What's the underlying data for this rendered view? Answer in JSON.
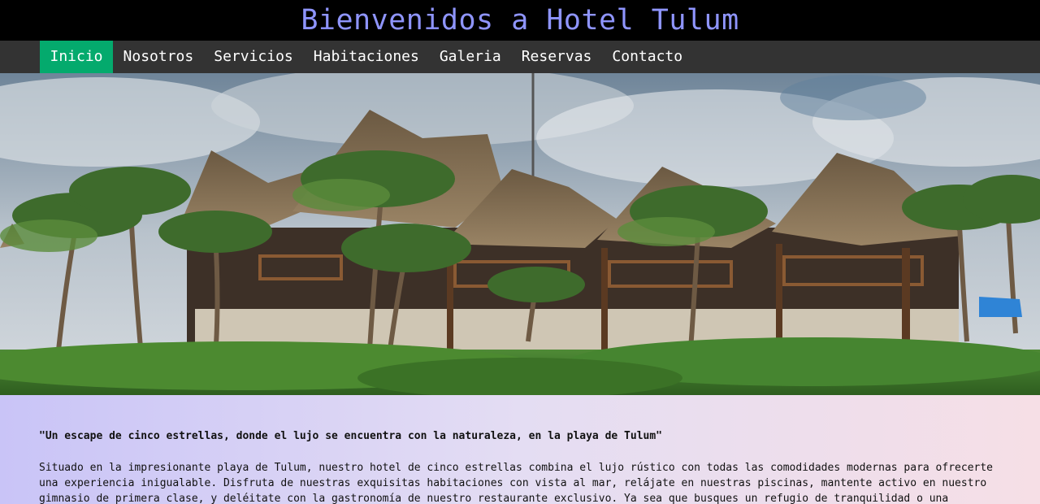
{
  "header": {
    "title": "Bienvenidos a Hotel Tulum"
  },
  "nav": {
    "items": [
      {
        "label": "Inicio",
        "active": true
      },
      {
        "label": "Nosotros"
      },
      {
        "label": "Servicios"
      },
      {
        "label": "Habitaciones"
      },
      {
        "label": "Galeria"
      },
      {
        "label": "Reservas"
      },
      {
        "label": "Contacto"
      }
    ]
  },
  "hero": {
    "image": "hotel-tulum-palapa-cabanas-photo"
  },
  "main": {
    "tagline": "\"Un escape de cinco estrellas, donde el lujo se encuentra con la naturaleza, en la playa de Tulum\"",
    "description": "Situado en la impresionante playa de Tulum, nuestro hotel de cinco estrellas combina el lujo rústico con todas las comodidades modernas para ofrecerte una experiencia inigualable. Disfruta de nuestras exquisitas habitaciones con vista al mar, relájate en nuestras piscinas, mantente activo en nuestro gimnasio de primera clase, y deléitate con la gastronomía de nuestro restaurante exclusivo. Ya sea que busques un refugio de tranquilidad o una aventura emocionante, el"
  },
  "colors": {
    "title": "#8f95ff",
    "nav_background": "#333333",
    "nav_active": "#04aa6d",
    "content_gradient_start": "#c9c4f7",
    "content_gradient_end": "#f6dfe6"
  }
}
